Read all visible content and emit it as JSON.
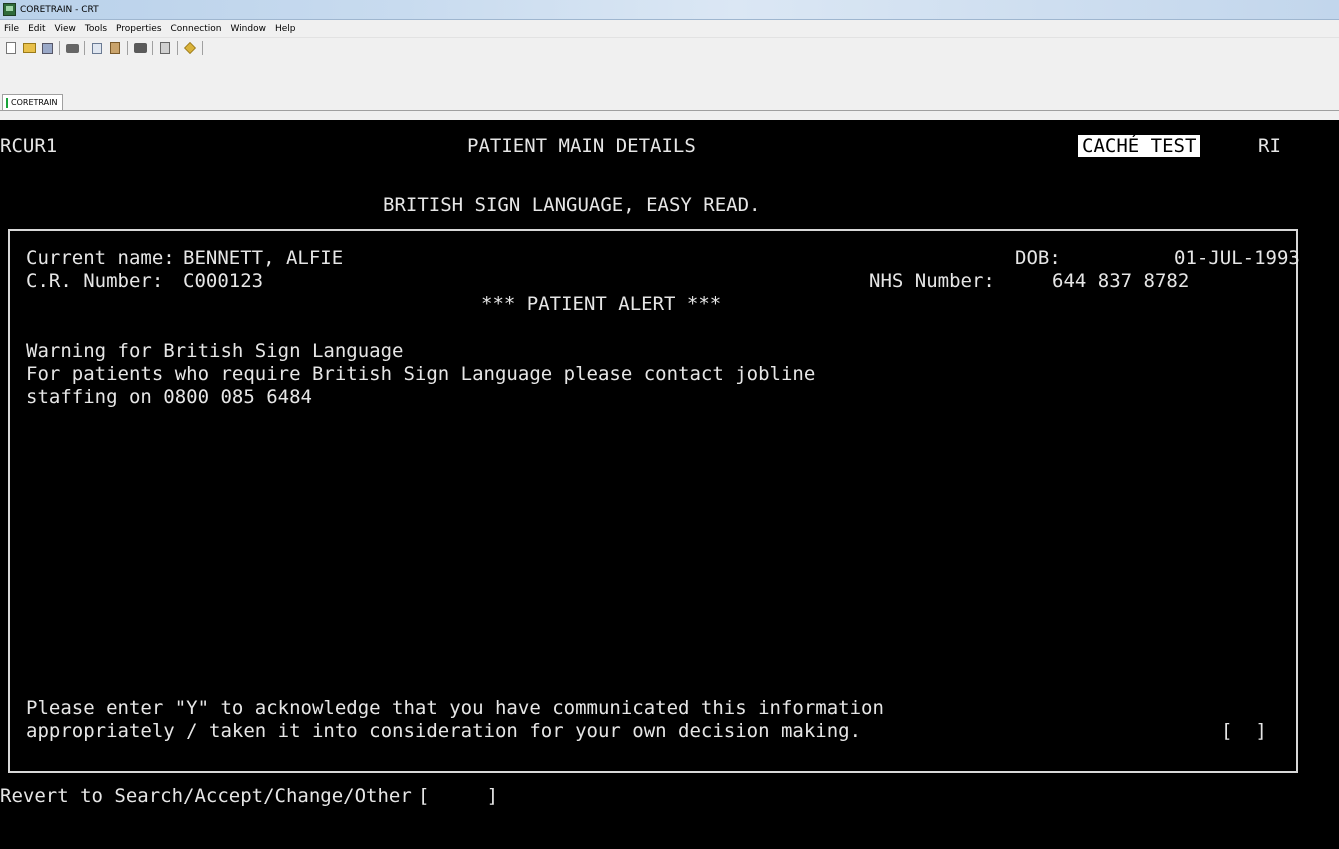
{
  "window": {
    "title": "CORETRAIN - CRT"
  },
  "menu": {
    "items": [
      "File",
      "Edit",
      "View",
      "Tools",
      "Properties",
      "Connection",
      "Window",
      "Help"
    ]
  },
  "toolbar": {
    "icons": [
      "new-icon",
      "open-icon",
      "save-icon",
      "print-icon",
      "copy-icon",
      "paste-icon",
      "screen-capture-icon",
      "document-icon",
      "key-icon"
    ]
  },
  "session_tab": {
    "label": "CORETRAIN"
  },
  "screen": {
    "screen_id": "RCUR1",
    "heading": "PATIENT MAIN DETAILS",
    "env_badge": "CACHÉ TEST",
    "env_suffix": "RI",
    "subheading": "BRITISH SIGN LANGUAGE, EASY READ."
  },
  "patient": {
    "name_label": "Current name:",
    "name": "BENNETT, ALFIE",
    "dob_label": "DOB:",
    "dob": "01-JUL-1993",
    "cr_label": "C.R. Number:",
    "cr_number": "C000123",
    "nhs_label": "NHS Number:",
    "nhs_number": "644 837 8782"
  },
  "alert": {
    "banner": "*** PATIENT ALERT ***",
    "line1": "Warning for British Sign Language",
    "line2": "For patients who require British Sign Language please contact jobline",
    "line3": "staffing on 0800 085 6484",
    "ack_line1": "Please enter \"Y\" to acknowledge that you have communicated this information",
    "ack_line2": "appropriately / taken it into consideration for your own decision making.",
    "ack_input": "[  ]"
  },
  "command": {
    "prompt": "Revert to Search/Accept/Change/Other",
    "input": "[     ]"
  }
}
